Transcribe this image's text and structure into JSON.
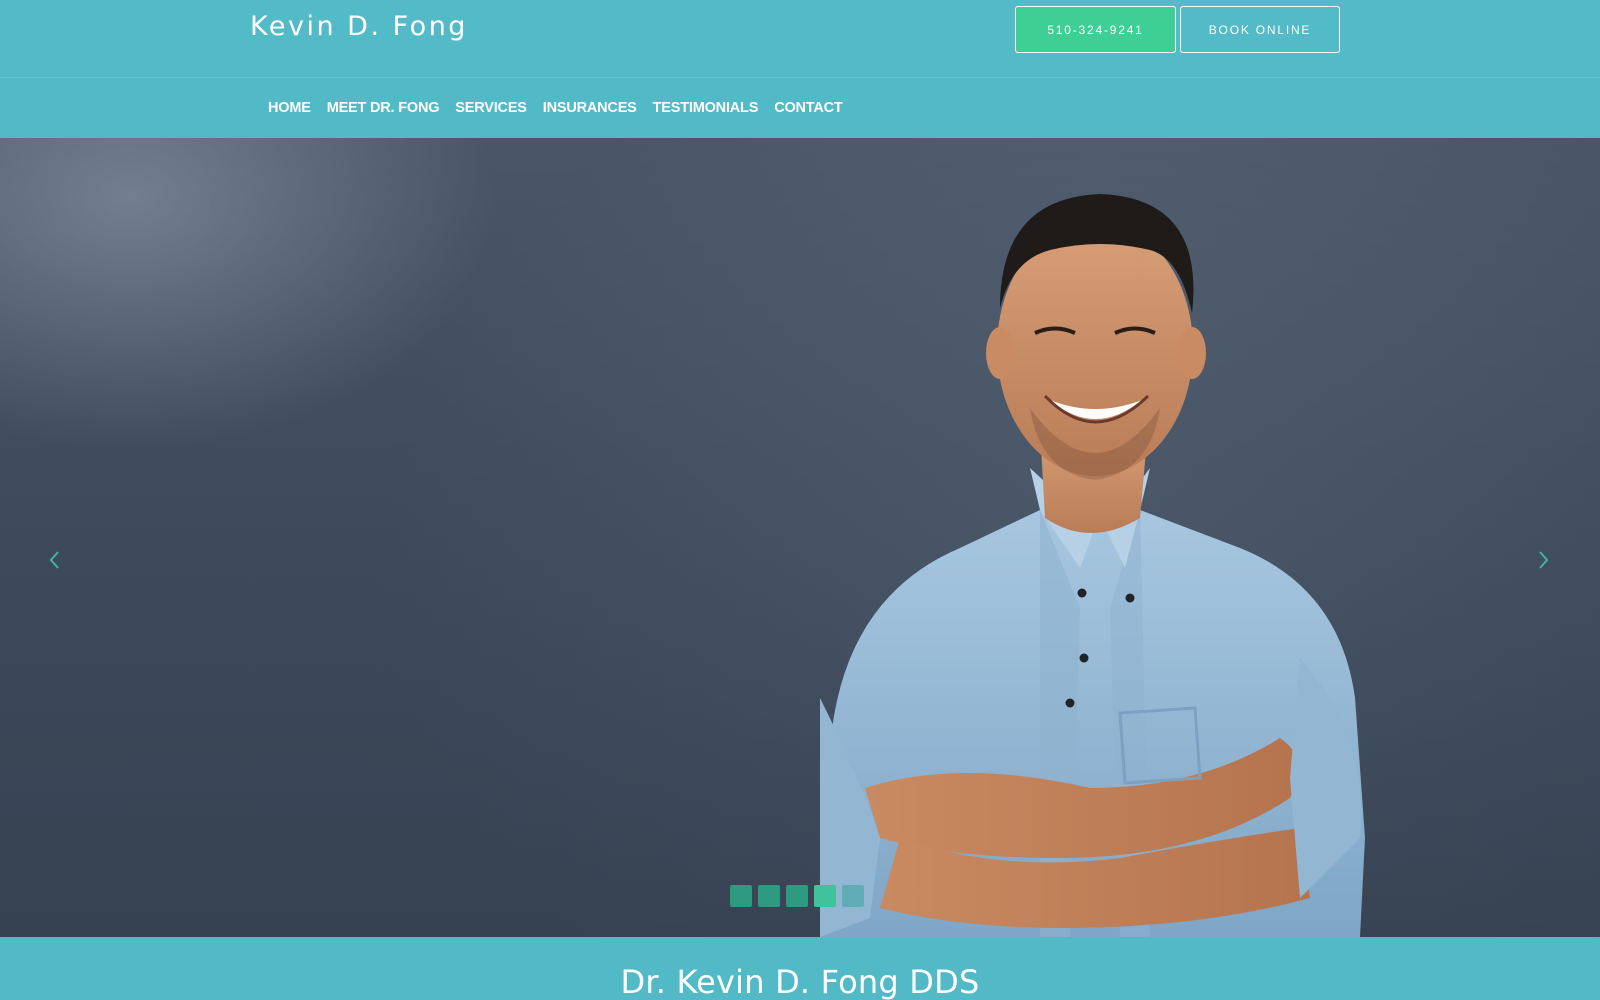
{
  "header": {
    "brand": "Kevin D. Fong",
    "phone_button": "510-324-9241",
    "book_button": "BOOK ONLINE"
  },
  "nav": {
    "items": [
      {
        "label": "HOME"
      },
      {
        "label": "MEET DR. FONG"
      },
      {
        "label": "SERVICES"
      },
      {
        "label": "INSURANCES"
      },
      {
        "label": "TESTIMONIALS"
      },
      {
        "label": "CONTACT"
      }
    ]
  },
  "hero": {
    "image": "smiling-man-denim-shirt-crossed-arms",
    "prev_icon": "chevron-left-icon",
    "next_icon": "chevron-right-icon",
    "slides_total": 5,
    "active_slide": 4
  },
  "intro": {
    "title": "Dr. Kevin D. Fong DDS"
  },
  "colors": {
    "header_bg": "#53bac8",
    "phone_button_bg": "#3ecf95",
    "slider_dot": "#2e9a82",
    "slider_dot_active": "#3fc39a"
  }
}
